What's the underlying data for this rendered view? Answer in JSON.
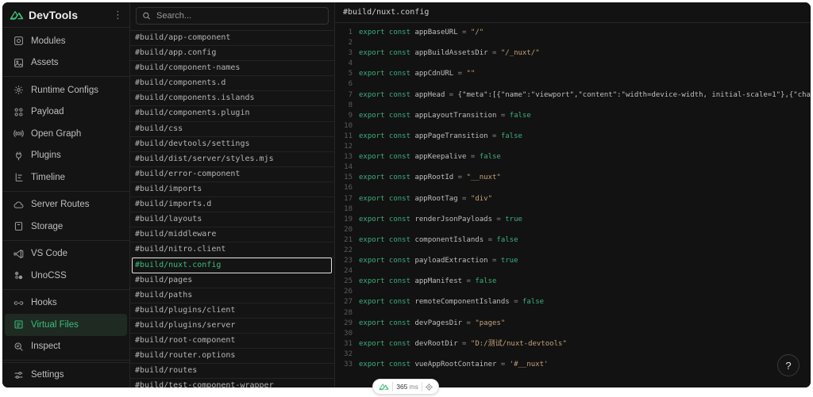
{
  "app": {
    "name": "DevTools",
    "brand_color": "#3dbd79"
  },
  "sidebar": {
    "groups": [
      [
        {
          "label": "Modules",
          "icon": "modules-icon"
        },
        {
          "label": "Assets",
          "icon": "assets-icon"
        }
      ],
      [
        {
          "label": "Runtime Configs",
          "icon": "gear-icon"
        },
        {
          "label": "Payload",
          "icon": "payload-icon"
        },
        {
          "label": "Open Graph",
          "icon": "open-graph-icon"
        },
        {
          "label": "Plugins",
          "icon": "plug-icon"
        },
        {
          "label": "Timeline",
          "icon": "timeline-icon"
        }
      ],
      [
        {
          "label": "Server Routes",
          "icon": "cloud-icon"
        },
        {
          "label": "Storage",
          "icon": "storage-icon"
        }
      ],
      [
        {
          "label": "VS Code",
          "icon": "vscode-icon"
        },
        {
          "label": "UnoCSS",
          "icon": "unocss-icon"
        }
      ],
      [
        {
          "label": "Hooks",
          "icon": "hooks-icon"
        },
        {
          "label": "Virtual Files",
          "icon": "file-icon",
          "active": true
        },
        {
          "label": "Inspect",
          "icon": "inspect-icon"
        }
      ]
    ],
    "bottom": {
      "label": "Settings",
      "icon": "settings-icon"
    }
  },
  "search": {
    "placeholder": "Search..."
  },
  "files": [
    "#build/app-component",
    "#build/app.config",
    "#build/component-names",
    "#build/components.d",
    "#build/components.islands",
    "#build/components.plugin",
    "#build/css",
    "#build/devtools/settings",
    "#build/dist/server/styles.mjs",
    "#build/error-component",
    "#build/imports",
    "#build/imports.d",
    "#build/layouts",
    "#build/middleware",
    "#build/nitro.client",
    "#build/nuxt.config",
    "#build/pages",
    "#build/paths",
    "#build/plugins/client",
    "#build/plugins/server",
    "#build/root-component",
    "#build/router.options",
    "#build/routes",
    "#build/test-component-wrapper"
  ],
  "active_file": "#build/nuxt.config",
  "code": {
    "title": "#build/nuxt.config",
    "lines": [
      {
        "n": "1",
        "name": "appBaseURL",
        "value": "\"/\"",
        "kind": "str"
      },
      {
        "n": "2"
      },
      {
        "n": "3",
        "name": "appBuildAssetsDir",
        "value": "\"/_nuxt/\"",
        "kind": "str"
      },
      {
        "n": "4"
      },
      {
        "n": "5",
        "name": "appCdnURL",
        "value": "\"\"",
        "kind": "str"
      },
      {
        "n": "6"
      },
      {
        "n": "7",
        "name": "appHead",
        "value": "{\"meta\":[{\"name\":\"viewport\",\"content\":\"width=device-width, initial-scale=1\"},{\"charset\":",
        "kind": "obj"
      },
      {
        "n": "8"
      },
      {
        "n": "9",
        "name": "appLayoutTransition",
        "value": "false",
        "kind": "bool"
      },
      {
        "n": "10"
      },
      {
        "n": "11",
        "name": "appPageTransition",
        "value": "false",
        "kind": "bool"
      },
      {
        "n": "12"
      },
      {
        "n": "13",
        "name": "appKeepalive",
        "value": "false",
        "kind": "bool"
      },
      {
        "n": "14"
      },
      {
        "n": "15",
        "name": "appRootId",
        "value": "\"__nuxt\"",
        "kind": "str"
      },
      {
        "n": "16"
      },
      {
        "n": "17",
        "name": "appRootTag",
        "value": "\"div\"",
        "kind": "str"
      },
      {
        "n": "18"
      },
      {
        "n": "19",
        "name": "renderJsonPayloads",
        "value": "true",
        "kind": "bool"
      },
      {
        "n": "20"
      },
      {
        "n": "21",
        "name": "componentIslands",
        "value": "false",
        "kind": "bool"
      },
      {
        "n": "22"
      },
      {
        "n": "23",
        "name": "payloadExtraction",
        "value": "true",
        "kind": "bool"
      },
      {
        "n": "24"
      },
      {
        "n": "25",
        "name": "appManifest",
        "value": "false",
        "kind": "bool"
      },
      {
        "n": "26"
      },
      {
        "n": "27",
        "name": "remoteComponentIslands",
        "value": "false",
        "kind": "bool"
      },
      {
        "n": "28"
      },
      {
        "n": "29",
        "name": "devPagesDir",
        "value": "\"pages\"",
        "kind": "str"
      },
      {
        "n": "30"
      },
      {
        "n": "31",
        "name": "devRootDir",
        "value": "\"D:/测试/nuxt-devtools\"",
        "kind": "str"
      },
      {
        "n": "32"
      },
      {
        "n": "33",
        "name": "vueAppRootContainer",
        "value": "'#__nuxt'",
        "kind": "str"
      }
    ],
    "keywords": "export const"
  },
  "help": {
    "label": "?"
  },
  "timing": {
    "value": "365",
    "unit": "ms"
  }
}
